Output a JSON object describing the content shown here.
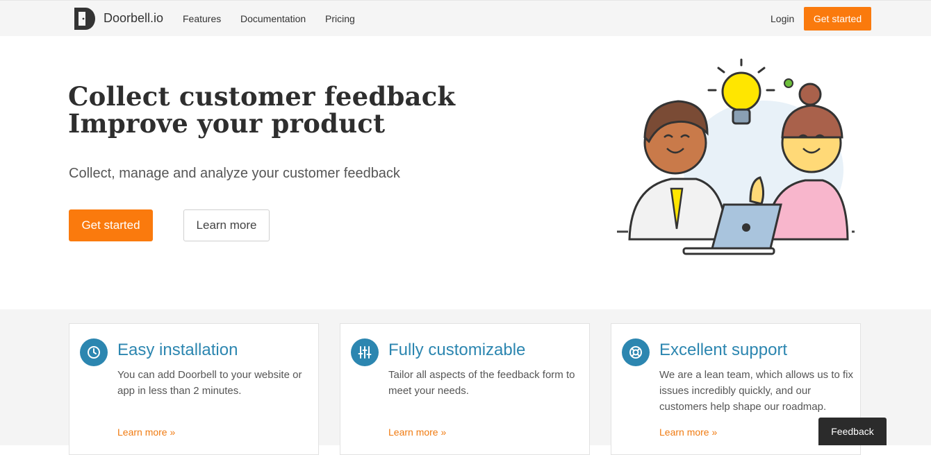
{
  "nav": {
    "brand": "Doorbell.io",
    "links": [
      "Features",
      "Documentation",
      "Pricing"
    ],
    "login": "Login",
    "cta": "Get started"
  },
  "hero": {
    "title_line1": "Collect customer feedback",
    "title_line2": "Improve your product",
    "subtitle": "Collect, manage and analyze your customer feedback",
    "primary_button": "Get started",
    "secondary_button": "Learn more"
  },
  "features": [
    {
      "icon": "clock-icon",
      "title": "Easy installation",
      "text": "You can add Doorbell to your website or app in less than 2 minutes.",
      "link": "Learn more »"
    },
    {
      "icon": "sliders-icon",
      "title": "Fully customizable",
      "text": "Tailor all aspects of the feedback form to meet your needs.",
      "link": "Learn more »"
    },
    {
      "icon": "lifebuoy-icon",
      "title": "Excellent support",
      "text": "We are a lean team, which allows us to fix issues incredibly quickly, and our customers help shape our roadmap.",
      "link": "Learn more »"
    }
  ],
  "feedback_tab": "Feedback",
  "colors": {
    "accent": "#fa7a0d",
    "feature_blue": "#2c86b0",
    "nav_bg": "#f5f5f5"
  }
}
